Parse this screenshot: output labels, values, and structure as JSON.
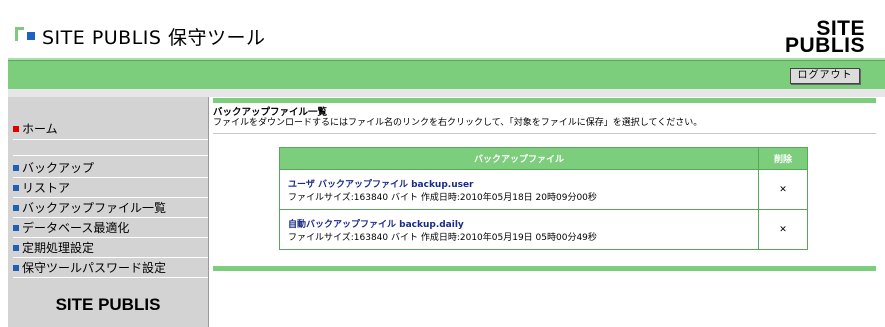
{
  "header": {
    "title": "SITE PUBLIS 保守ツール",
    "brand_line1": "SITE",
    "brand_line2": "PUBLIS",
    "logout_label": "ログアウト"
  },
  "sidebar": {
    "items": [
      {
        "label": "ホーム",
        "marker": "red"
      },
      {
        "label": "バックアップ",
        "marker": "blue"
      },
      {
        "label": "リストア",
        "marker": "blue"
      },
      {
        "label": "バックアップファイル一覧",
        "marker": "blue"
      },
      {
        "label": "データベース最適化",
        "marker": "blue"
      },
      {
        "label": "定期処理設定",
        "marker": "blue"
      },
      {
        "label": "保守ツールパスワード設定",
        "marker": "blue"
      }
    ],
    "footer_logo": "SITE PUBLIS"
  },
  "main": {
    "section_title": "バックアップファイル一覧",
    "description": "ファイルをダウンロードするにはファイル名のリンクを右クリックして、「対象をファイルに保存」を選択してください。",
    "table": {
      "columns": [
        "バックアップファイル",
        "削除"
      ],
      "rows": [
        {
          "name": "ユーザ バックアップファイル backup.user",
          "meta": "ファイルサイズ:163840 バイト 作成日時:2010年05月18日 20時09分00秒",
          "delete": "✕"
        },
        {
          "name": "自動バックアップファイル backup.daily",
          "meta": "ファイルサイズ:163840 バイト 作成日時:2010年05月19日 05時00分49秒",
          "delete": "✕"
        }
      ]
    }
  },
  "colors": {
    "accent_green": "#7ccd7c",
    "sidebar_gray": "#d3d3d3",
    "marker_red": "#e00000",
    "marker_blue": "#1f5fb8",
    "link_blue": "#1a2a8a"
  }
}
